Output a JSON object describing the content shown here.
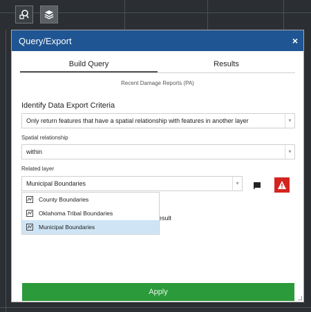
{
  "toolbar": {
    "tools": [
      {
        "name": "query-tool",
        "icon": "query-icon"
      },
      {
        "name": "layers-tool",
        "icon": "layers-icon"
      }
    ]
  },
  "dialog": {
    "title": "Query/Export",
    "close_label": "×",
    "tabs": [
      {
        "label": "Build Query",
        "active": true
      },
      {
        "label": "Results",
        "active": false
      }
    ],
    "layer_name": "Recent Damage Reports (PA)",
    "section_title": "Identify Data Export Criteria",
    "criteria_select": {
      "value": "Only return features that have a spatial relationship with features in another layer"
    },
    "spatial_relationship": {
      "label": "Spatial relationship",
      "value": "within"
    },
    "related_layer": {
      "label": "Related layer",
      "value": "Municipal Boundaries",
      "options": [
        {
          "label": "County Boundaries",
          "selected": false
        },
        {
          "label": "Oklahoma Tribal Boundaries",
          "selected": false
        },
        {
          "label": "Municipal Boundaries",
          "selected": true
        }
      ]
    },
    "partial_hidden_text": "esult",
    "apply_label": "Apply",
    "colors": {
      "titlebar": "#1f5592",
      "apply": "#2b9a3a",
      "warning": "#d32420",
      "selected_option": "#cfe5f5"
    }
  }
}
